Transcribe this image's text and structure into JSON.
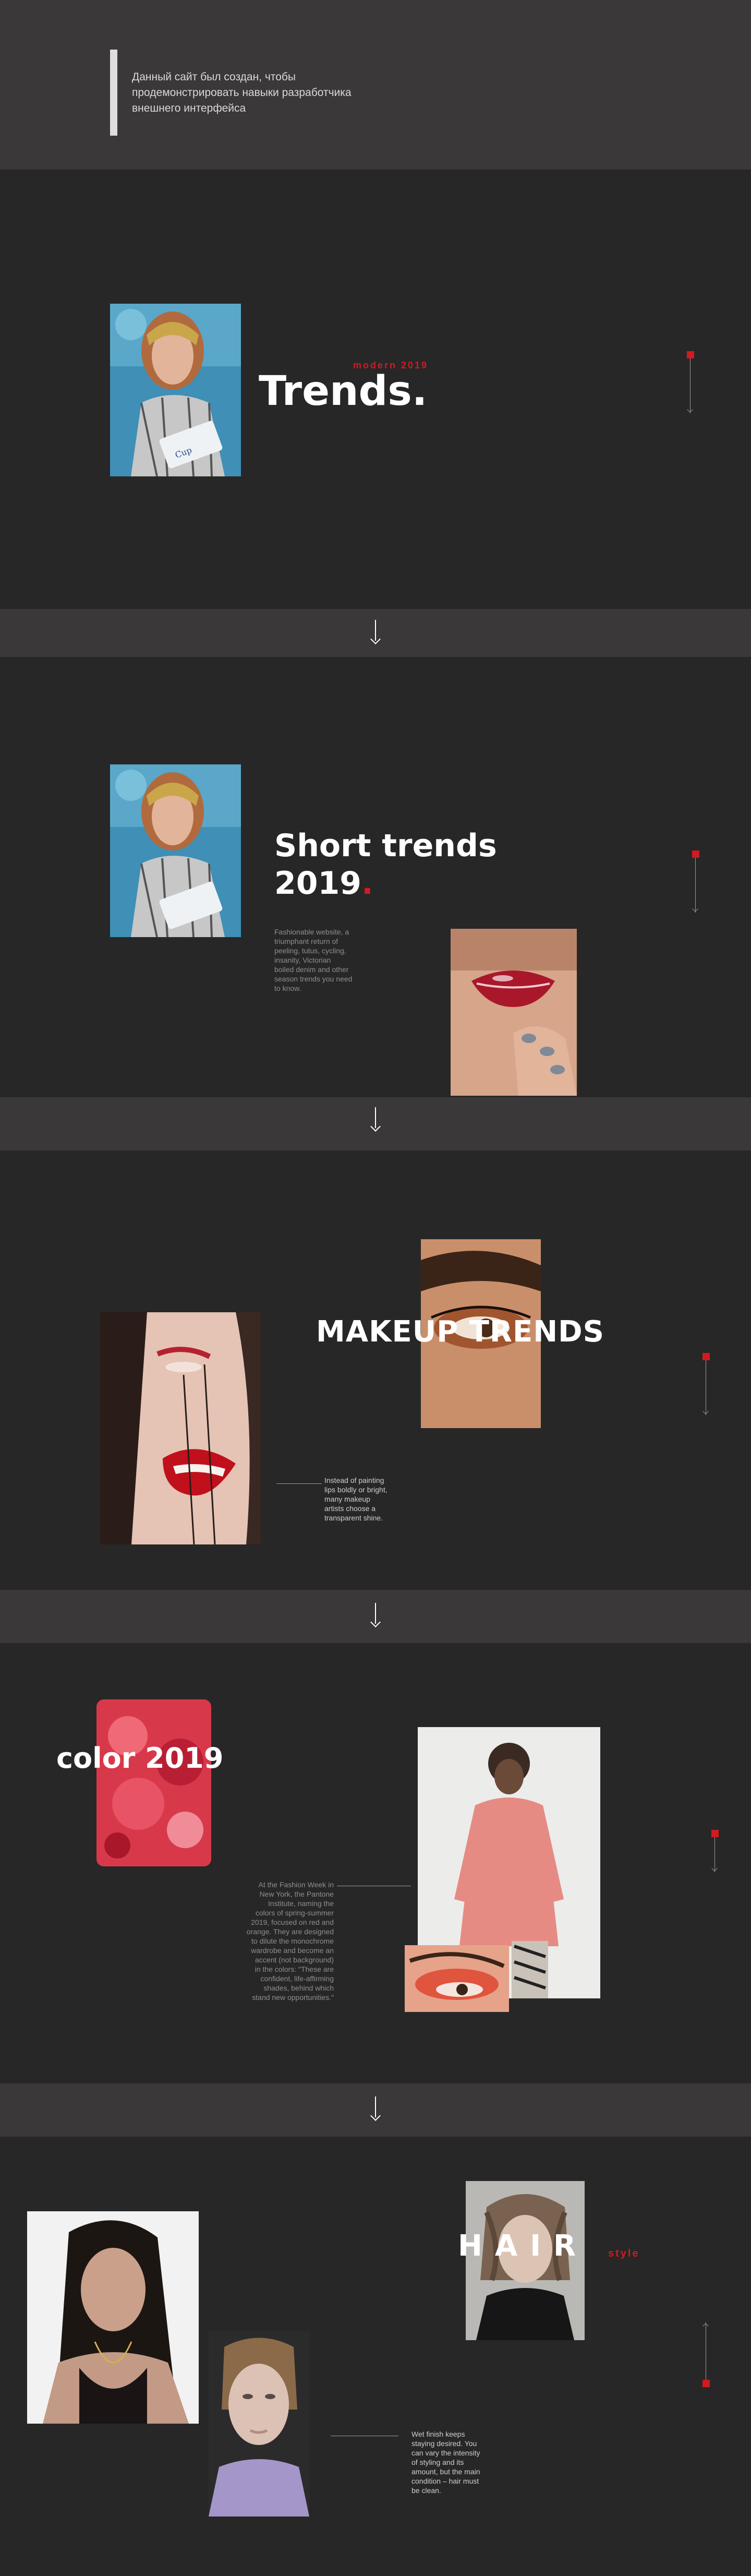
{
  "header": {
    "notice_line1": "Данный сайт был создан, чтобы",
    "notice_line2": "продемонстрировать навыки разработчика",
    "notice_line3": "внешнего интерфейса"
  },
  "hero": {
    "kicker": "modern 2019",
    "title": "Trends."
  },
  "short_trends": {
    "title_line1": "Short trends",
    "title_line2": "2019",
    "title_dot": ".",
    "body_lines": [
      "Fashionable website, a",
      "triumphant return of",
      "peeling, tutus, cycling,",
      "insanity, Victorian",
      "boiled denim and other",
      "season trends you need",
      "to know."
    ]
  },
  "makeup": {
    "title": "MAKEUP TRENDS",
    "body_lines": [
      "Instead of painting",
      "lips boldly or bright,",
      "many makeup",
      "artists choose a",
      "transparent shine."
    ]
  },
  "color": {
    "title": "color 2019",
    "body_lines": [
      "At the Fashion Week in",
      "New York, the Pantone",
      "Institute, naming the",
      "colors of spring-summer",
      "2019, focused on red and",
      "orange. They are designed",
      "to dilute the monochrome",
      "wardrobe and become an",
      "accent (not background)",
      "in the colors: \"These are",
      "confident, life-affirming",
      "shades, behind which",
      "stand new opportunities.\""
    ]
  },
  "hair": {
    "title": "HAIR",
    "kicker": "style",
    "body_lines": [
      "Wet finish keeps",
      "staying desired. You",
      "can vary the intensity",
      "of styling and its",
      "amount, but the main",
      "condition – hair must",
      "be clean."
    ]
  },
  "icons": {
    "down_arrow": "down-arrow-icon",
    "scroll_indicator": "scroll-indicator-icon"
  },
  "colors": {
    "background": "#272727",
    "band": "#3a3838",
    "accent": "#d21a20"
  }
}
